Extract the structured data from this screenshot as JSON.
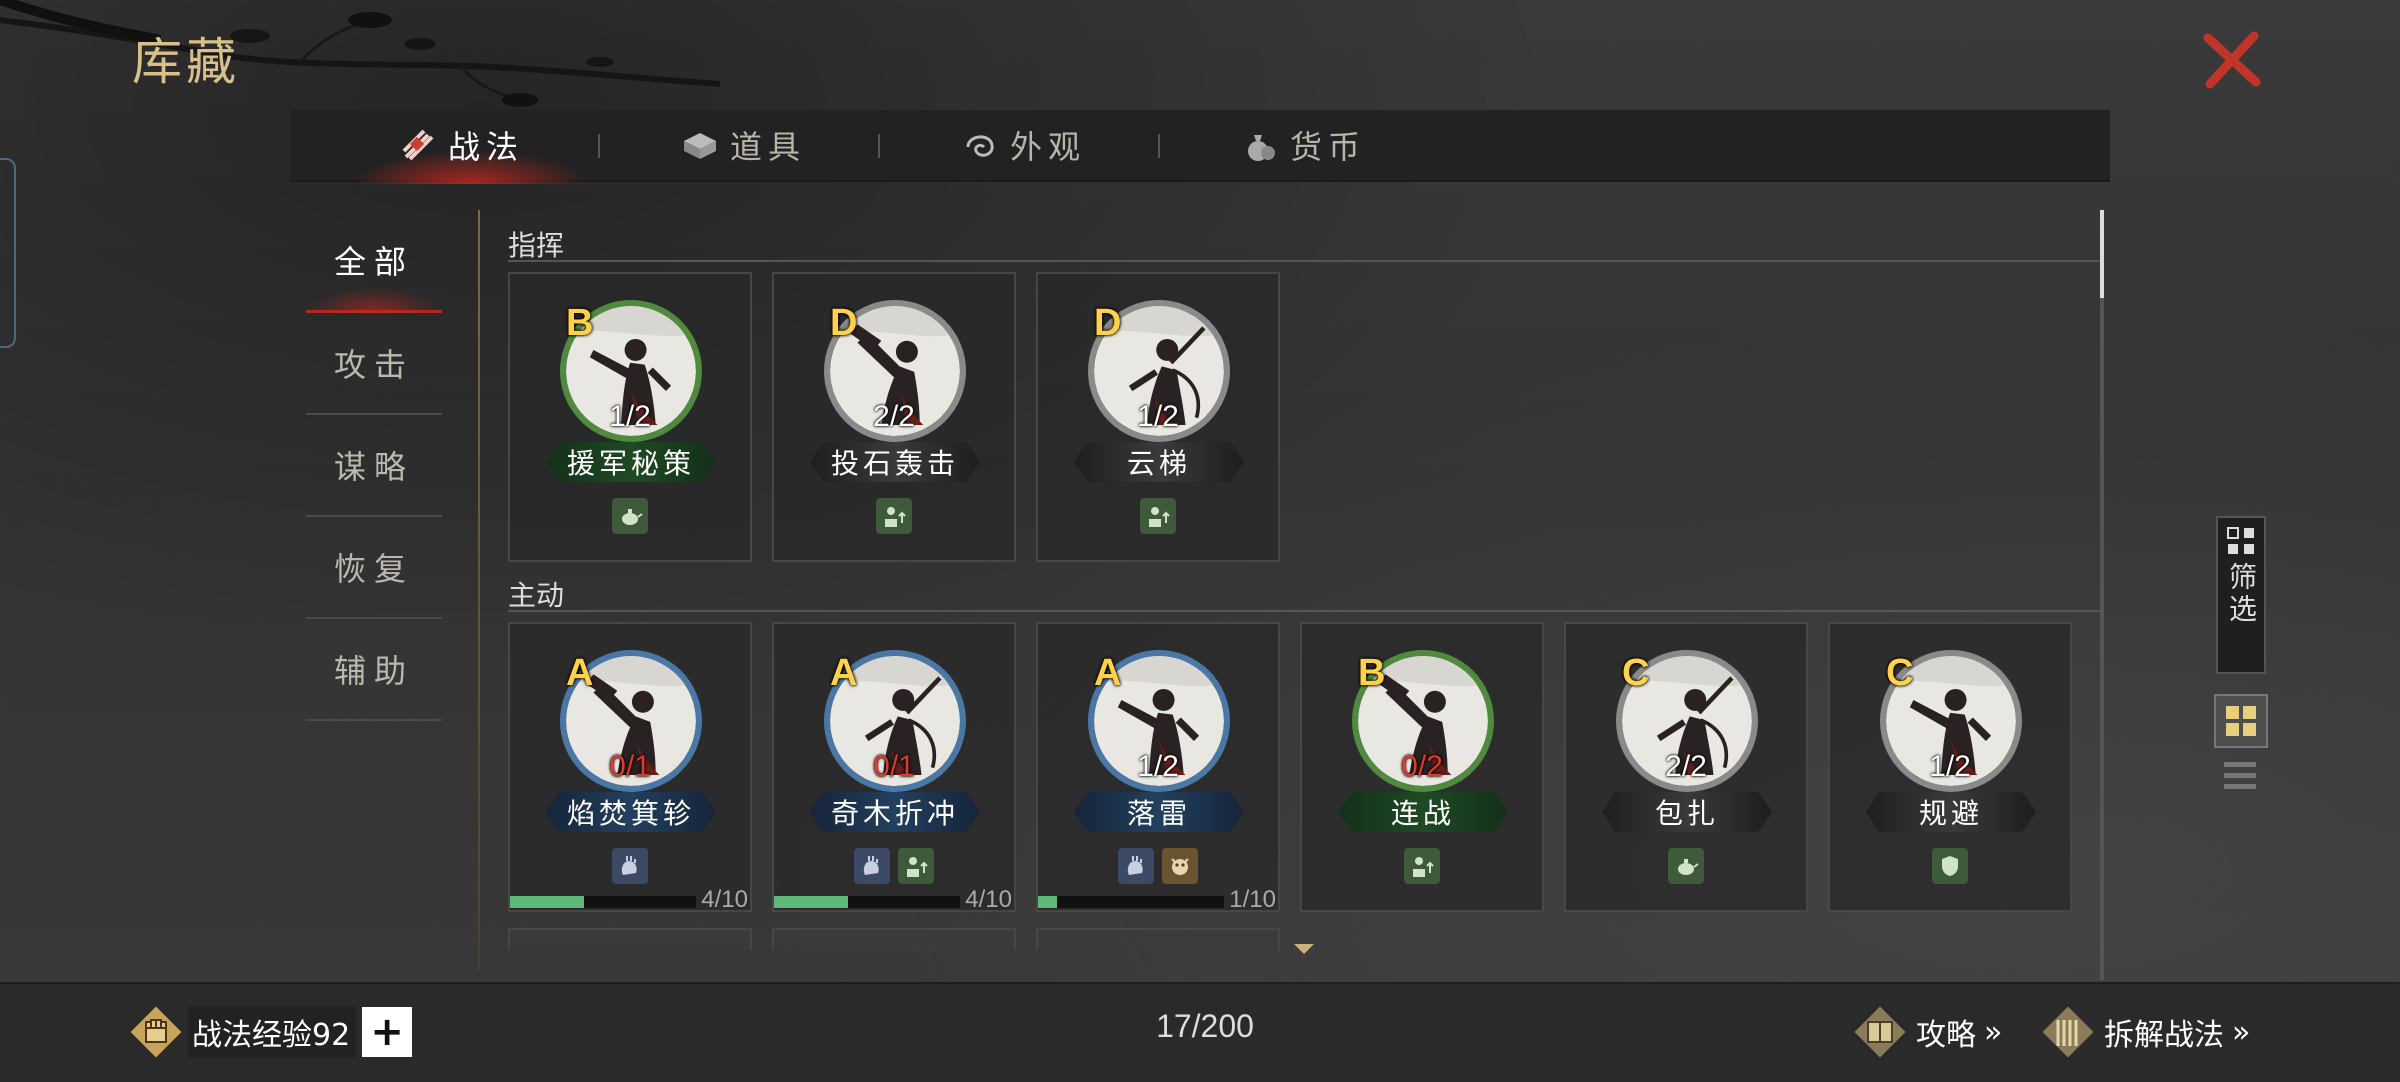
{
  "header": {
    "title": "库藏"
  },
  "tabs": [
    {
      "label": "战法",
      "icon": "scroll-bundle-icon",
      "active": true
    },
    {
      "label": "道具",
      "icon": "box-icon",
      "active": false
    },
    {
      "label": "外观",
      "icon": "swirl-icon",
      "active": false
    },
    {
      "label": "货币",
      "icon": "money-bag-icon",
      "active": false
    }
  ],
  "sidebar": {
    "items": [
      {
        "label": "全部",
        "active": true
      },
      {
        "label": "攻击"
      },
      {
        "label": "谋略"
      },
      {
        "label": "恢复"
      },
      {
        "label": "辅助"
      }
    ]
  },
  "sections": {
    "command": {
      "title": "指挥",
      "cards": [
        {
          "grade": "B",
          "count": "1/2",
          "name": "援军秘策",
          "tier": "green",
          "tags": [
            "teapot-icon"
          ]
        },
        {
          "grade": "D",
          "count": "2/2",
          "name": "投石轰击",
          "tier": "gray",
          "tags": [
            "soldier-up-icon"
          ]
        },
        {
          "grade": "D",
          "count": "1/2",
          "name": "云梯",
          "tier": "gray",
          "tags": [
            "soldier-up-icon"
          ]
        }
      ]
    },
    "active": {
      "title": "主动",
      "cards": [
        {
          "grade": "A",
          "count": "0/1",
          "count_red": true,
          "name": "焰焚箕轸",
          "tier": "blue",
          "tags": [
            "hand-icon"
          ],
          "progress_text": "4/10",
          "progress": 0.4
        },
        {
          "grade": "A",
          "count": "0/1",
          "count_red": true,
          "name": "奇木折冲",
          "tier": "blue",
          "tags": [
            "hand-icon",
            "soldier-up-icon"
          ],
          "progress_text": "4/10",
          "progress": 0.4
        },
        {
          "grade": "A",
          "count": "1/2",
          "count_red": false,
          "name": "落雷",
          "tier": "blue",
          "tags": [
            "hand-icon",
            "beast-icon"
          ],
          "progress_text": "1/10",
          "progress": 0.1
        },
        {
          "grade": "B",
          "count": "0/2",
          "count_red": true,
          "name": "连战",
          "tier": "green",
          "tags": [
            "soldier-up-icon"
          ]
        },
        {
          "grade": "C",
          "count": "2/2",
          "count_red": false,
          "name": "包扎",
          "tier": "gray",
          "tags": [
            "teapot-icon"
          ]
        },
        {
          "grade": "C",
          "count": "1/2",
          "count_red": false,
          "name": "规避",
          "tier": "gray",
          "tags": [
            "shield-icon"
          ]
        }
      ]
    }
  },
  "filter": {
    "label": "筛选"
  },
  "bottom": {
    "exp_label": "战法经验92",
    "plus": "+",
    "capacity": "17/200",
    "guide": "攻略",
    "dismantle": "拆解战法"
  },
  "colors": {
    "tier_green": "#4f8a3e",
    "tier_blue": "#4a78a6",
    "tier_gray": "#8a8a8a",
    "accent_red": "#b0261f",
    "grade_yellow": "#ffd24a",
    "progress_green": "#5fb87a"
  }
}
